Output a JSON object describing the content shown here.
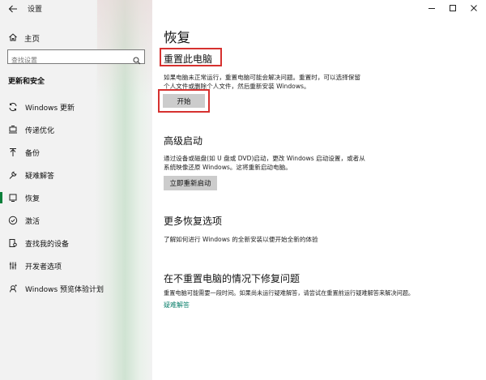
{
  "window": {
    "app_title": "设置",
    "accent": "#0a7f3a",
    "highlight_red": "#d6312f"
  },
  "sidebar": {
    "home_label": "主页",
    "search_placeholder": "查找设置",
    "section_title": "更新和安全",
    "items": [
      {
        "label": "Windows 更新",
        "icon": "sync-icon",
        "active": false
      },
      {
        "label": "传递优化",
        "icon": "delivery-optimization-icon",
        "active": false
      },
      {
        "label": "备份",
        "icon": "backup-arrow-icon",
        "active": false
      },
      {
        "label": "疑难解答",
        "icon": "wrench-icon",
        "active": false
      },
      {
        "label": "恢复",
        "icon": "recovery-icon",
        "active": true
      },
      {
        "label": "激活",
        "icon": "check-circle-icon",
        "active": false
      },
      {
        "label": "查找我的设备",
        "icon": "find-device-icon",
        "active": false
      },
      {
        "label": "开发者选项",
        "icon": "developer-icon",
        "active": false
      },
      {
        "label": "Windows 预览体验计划",
        "icon": "insider-icon",
        "active": false
      }
    ]
  },
  "main": {
    "page_title": "恢复",
    "reset": {
      "title": "重置此电脑",
      "desc_line1": "如果电脑未正常运行，重置电脑可能会解决问题。重置时，可以选择保留",
      "desc_line2": "个人文件或删除个人文件，然后重新安装 Windows。",
      "button": "开始"
    },
    "advanced": {
      "title": "高级启动",
      "desc_line1": "通过设备或磁盘(如 U 盘或 DVD)启动，更改 Windows 启动设置，或者从",
      "desc_line2": "系统映像还原 Windows。这将重新启动电脑。",
      "button": "立即重新启动"
    },
    "more": {
      "title": "更多恢复选项",
      "desc": "了解如何进行 Windows 的全新安装以便开始全新的体验"
    },
    "fix": {
      "title": "在不重置电脑的情况下修复问题",
      "desc": "重置电脑可能需要一段时间。如果尚未运行疑难解答，请尝试在重置前运行疑难解答来解决问题。",
      "link": "疑难解答"
    }
  }
}
